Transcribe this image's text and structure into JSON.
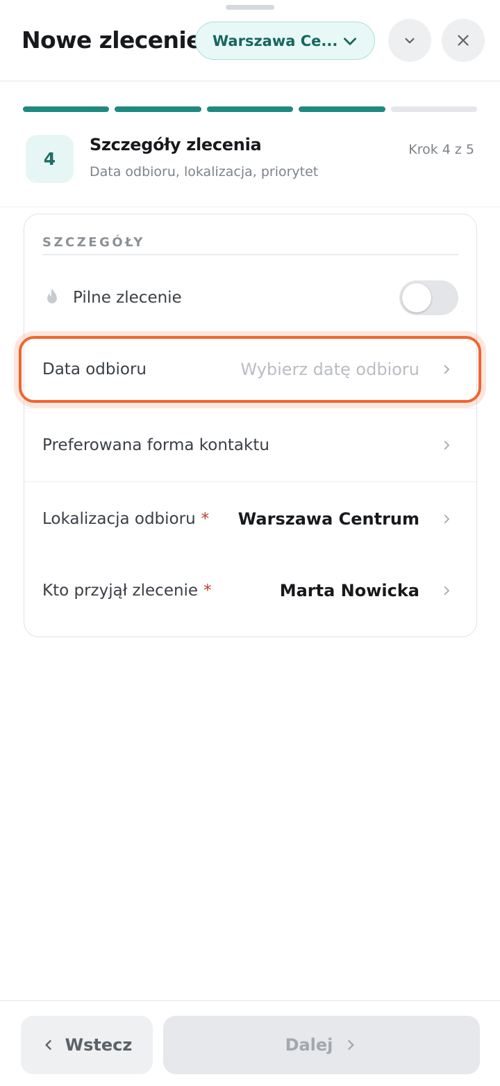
{
  "header": {
    "title": "Nowe zlecenie",
    "branch_selector": "Warszawa Ce..."
  },
  "progress": {
    "total_steps": 5,
    "completed_steps": 4
  },
  "step": {
    "number": "4",
    "title": "Szczegóły zlecenia",
    "subtitle": "Data odbioru, lokalizacja, priorytet",
    "counter": "Krok 4 z 5"
  },
  "details": {
    "section_label": "SZCZEGÓŁY",
    "urgent": {
      "label": "Pilne zlecenie",
      "enabled": false
    },
    "pickup_date": {
      "label": "Data odbioru",
      "placeholder": "Wybierz datę odbioru"
    },
    "contact": {
      "label": "Preferowana forma kontaktu",
      "value": ""
    },
    "location": {
      "label": "Lokalizacja odbioru",
      "required_mark": "*",
      "value": "Warszawa Centrum"
    },
    "receiver": {
      "label": "Kto przyjął zlecenie",
      "required_mark": "*",
      "value": "Marta Nowicka"
    }
  },
  "footer": {
    "back_label": "Wstecz",
    "next_label": "Dalej"
  },
  "colors": {
    "accent": "#1f8a80",
    "highlight": "#f0642f",
    "required": "#c53a2a"
  }
}
